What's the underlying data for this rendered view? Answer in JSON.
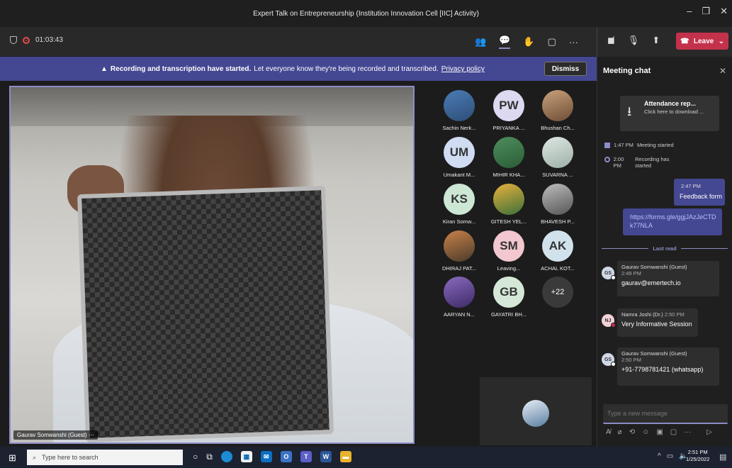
{
  "window": {
    "title": "Expert Talk on Entrepreneurship (Institution Innovation Cell [IIC] Activity)"
  },
  "toolbar": {
    "timer": "01:03:43",
    "leave_label": "Leave"
  },
  "banner": {
    "bold": "Recording and transcription have started.",
    "text": "Let everyone know they're being recorded and transcribed.",
    "link": "Privacy policy",
    "dismiss": "Dismiss"
  },
  "video": {
    "speaker_label": "Gaurav Somwanshi (Guest)",
    "more": "···"
  },
  "participants": [
    {
      "name": "Sachin Nerk...",
      "initials": "",
      "style": "photo"
    },
    {
      "name": "PRIYANKA ...",
      "initials": "PW",
      "style": "pw"
    },
    {
      "name": "Bhushan Ch...",
      "initials": "",
      "style": "p2"
    },
    {
      "name": "Umakant M...",
      "initials": "UM",
      "style": "um"
    },
    {
      "name": "MIHIR KHA...",
      "initials": "",
      "style": "p3"
    },
    {
      "name": "SUVARNA ...",
      "initials": "",
      "style": "p4"
    },
    {
      "name": "Kiran Somw...",
      "initials": "KS",
      "style": "ks"
    },
    {
      "name": "GITESH YEL...",
      "initials": "",
      "style": "p5"
    },
    {
      "name": "BHAVESH P...",
      "initials": "",
      "style": "p6"
    },
    {
      "name": "DHIRAJ PAT...",
      "initials": "",
      "style": "p7"
    },
    {
      "name": "Leaving...",
      "initials": "SM",
      "style": "sm"
    },
    {
      "name": "ACHAL KOT...",
      "initials": "AK",
      "style": "ak"
    },
    {
      "name": "AARYAN N...",
      "initials": "",
      "style": "p8"
    },
    {
      "name": "GAYATRI BH...",
      "initials": "GB",
      "style": "gb"
    },
    {
      "name": "",
      "initials": "+22",
      "style": "more"
    }
  ],
  "chat": {
    "title": "Meeting chat",
    "attachment": {
      "title": "Attendance rep...",
      "subtitle": "Click here to download ..."
    },
    "system": [
      {
        "time": "1:47 PM",
        "text": "Meeting started"
      },
      {
        "time": "2:00 PM",
        "text": "Recording has started"
      }
    ],
    "own_time": "2:47 PM",
    "own_message": "Feedback form",
    "own_link": "https://forms.gle/ggjJAzJeCTDk77NLA",
    "last_read": "Last read",
    "messages": [
      {
        "initials": "GS",
        "name": "Gaurav Somwanshi (Guest)",
        "time": "2:49 PM",
        "text": "gaurav@emertech.io",
        "status": "white"
      },
      {
        "initials": "NJ",
        "name": "Namra Joshi (Dr.)",
        "time": "2:50 PM",
        "text": "Very Informative Session",
        "status": "red"
      },
      {
        "initials": "GS",
        "name": "Gaurav Somwanshi (Guest)",
        "time": "2:50 PM",
        "text": "+91-7798781421 (whatsapp)",
        "status": "white"
      }
    ],
    "compose_placeholder": "Type a new message"
  },
  "taskbar": {
    "search_placeholder": "Type here to search",
    "time": "2:51 PM",
    "date": "1/25/2022"
  }
}
